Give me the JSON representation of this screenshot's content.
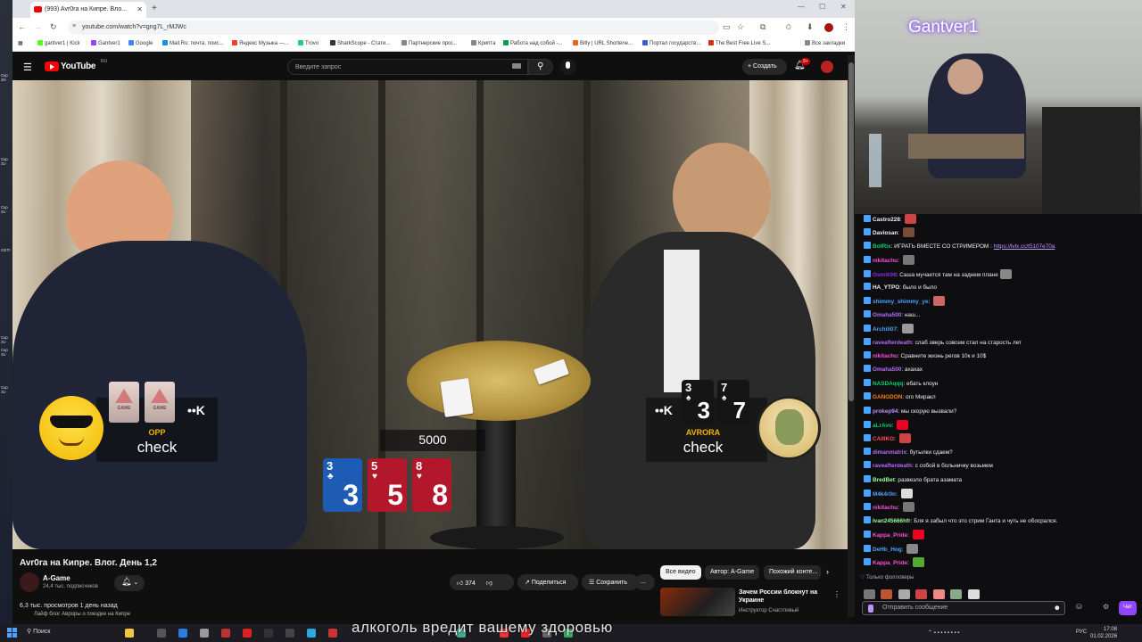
{
  "browser": {
    "tab_title": "(993) Avr0ra на Кипре. Вло...",
    "url": "youtube.com/watch?v=gng7L_rMJWc",
    "bookmarks": [
      "gantver1 | Kick",
      "Gantver1",
      "Google",
      "Mail.Ru: почта, поис...",
      "Яндекс Музыка —...",
      "Trovo",
      "SharkScope - Стати...",
      "Партнерские прог...",
      "Крипта",
      "Работа над собой -...",
      "Bitly | URL Shortene...",
      "Портал государств...",
      "The Best Free Live S...",
      "Все закладки"
    ]
  },
  "youtube": {
    "logo": "YouTube",
    "logo_region": "RU",
    "search_placeholder": "Введите запрос",
    "create_label": "Создать",
    "notif_count": "9+"
  },
  "overlay": {
    "opp": {
      "name": "OPP",
      "action": "check",
      "stack_icon": "••K",
      "card_brand": "GAME"
    },
    "avrora": {
      "name": "AVRORA",
      "action": "check",
      "stack_icon": "••K",
      "cards": [
        {
          "rank": "3",
          "suit": "♠",
          "big": "3"
        },
        {
          "rank": "7",
          "suit": "♠",
          "big": "7"
        }
      ]
    },
    "pot": "5000",
    "board": [
      {
        "rank": "3",
        "suit": "♣",
        "big": "3",
        "color": "blue"
      },
      {
        "rank": "5",
        "suit": "♥",
        "big": "5",
        "color": "red"
      },
      {
        "rank": "8",
        "suit": "♥",
        "big": "8",
        "color": "red"
      }
    ]
  },
  "video_info": {
    "title": "Avr0ra на Кипре. Влог. День 1,2",
    "channel": "A-Game",
    "subscribers": "24,4 тыс. подписчиков",
    "likes": "374",
    "share": "Поделиться",
    "save": "Сохранить",
    "more": "...",
    "views_line": "6,3 тыс. просмотров  1 день назад",
    "desc_cut": "Лайф блог Авроры о поездке на Кипре"
  },
  "recommend": {
    "chips": [
      "Все видео",
      "Автор: A-Game",
      "Похожий конте..."
    ],
    "title": "Зачем России блокнут на Украине",
    "author": "Инструктор Счастливый"
  },
  "stream": {
    "streamer": "Gantver1",
    "chat": [
      {
        "user": "Castro228",
        "text": "",
        "color": "#efeff1",
        "emote": "#c44"
      },
      {
        "user": "Daviosan",
        "text": "",
        "color": "#efeff1",
        "emote": "#7a4a3a"
      },
      {
        "user": "BotRix",
        "text": "ИГРАТЬ ВМЕСТЕ СО СТРИМЕРОМ :",
        "link": "https://lvlx.cc/t5107e70a",
        "color": "#00d26a",
        "emote": ""
      },
      {
        "user": "nikitachu",
        "text": "",
        "color": "#ff4fd8",
        "emote": "#777"
      },
      {
        "user": "Osmik98",
        "text": "Саша мучается там на заднем плане",
        "color": "#8a2be2",
        "emote": "#888"
      },
      {
        "user": "HA_YTPO",
        "text": "было и было",
        "color": "#efeff1",
        "emote": ""
      },
      {
        "user": "shimmy_shimmy_ye",
        "text": "",
        "color": "#4ea2ff",
        "emote": "#c66"
      },
      {
        "user": "Omaha500",
        "text": "наш...",
        "color": "#b56cff",
        "emote": ""
      },
      {
        "user": "Archili07",
        "text": "",
        "color": "#4ea2ff",
        "emote": "#999"
      },
      {
        "user": "raveafterdeath",
        "text": "слаб зверь совсем стал на старость лет",
        "color": "#b56cff",
        "emote": ""
      },
      {
        "user": "nikitachu",
        "text": "Сравните жизнь регов 10к и 10$",
        "color": "#ff4fd8",
        "emote": ""
      },
      {
        "user": "Omaha500",
        "text": "ахахах",
        "color": "#b56cff",
        "emote": ""
      },
      {
        "user": "NASDAqqq",
        "text": "ебать клоун",
        "color": "#00d26a",
        "emote": ""
      },
      {
        "user": "GANGDON",
        "text": "ого Миракл",
        "color": "#ff7f00",
        "emote": ""
      },
      {
        "user": "prokep94",
        "text": "мы скорую вызвали?",
        "color": "#c08aff",
        "emote": ""
      },
      {
        "user": "aLrAvo",
        "text": "",
        "color": "#00d26a",
        "emote": "#e02"
      },
      {
        "user": "CAIIIKO",
        "text": "",
        "color": "#ff4f4f",
        "emote": "#c44"
      },
      {
        "user": "dimanmatrix",
        "text": "бутылки сдаем?",
        "color": "#b56cff",
        "emote": ""
      },
      {
        "user": "raveafterdeath",
        "text": "с собой в больничку возьмем",
        "color": "#b56cff",
        "emote": ""
      },
      {
        "user": "BredBet",
        "text": "развезло брата азамата",
        "color": "#9aff9a",
        "emote": ""
      },
      {
        "user": "M4k4r0n",
        "text": "",
        "color": "#4ea2ff",
        "emote": "#ddd"
      },
      {
        "user": "nikitachu",
        "text": "",
        "color": "#ff4fd8",
        "emote": "#777"
      },
      {
        "user": "Ivan245666hfr",
        "text": "Бля я забыл что это стрим Ганта и чуть не обосрался.",
        "color": "#9aff9a",
        "emote": ""
      },
      {
        "user": "Kappa_Pride",
        "text": "",
        "color": "#ff4fd8",
        "emote": "#e02"
      },
      {
        "user": "DeHb_Hog",
        "text": "",
        "color": "#4ea2ff",
        "emote": "#888"
      },
      {
        "user": "Kappa_Pride",
        "text": "",
        "color": "#ff4fd8",
        "emote": "#5a3"
      }
    ],
    "followers_label": "Только фолловеры",
    "input_placeholder": "Отправить сообщение",
    "chat_button": "Чат"
  },
  "taskbar": {
    "search": "Поиск",
    "subtitle": "алкоголь вредит вашему здоровью",
    "lang": "РУС",
    "time": "17:08",
    "date": "01.02.2026"
  },
  "desktop": [
    "Скр 30-",
    "Скр 31-",
    "Скр 31-",
    "GETI",
    "Скр 31-",
    "Скр 31-",
    "Скр 31-"
  ]
}
